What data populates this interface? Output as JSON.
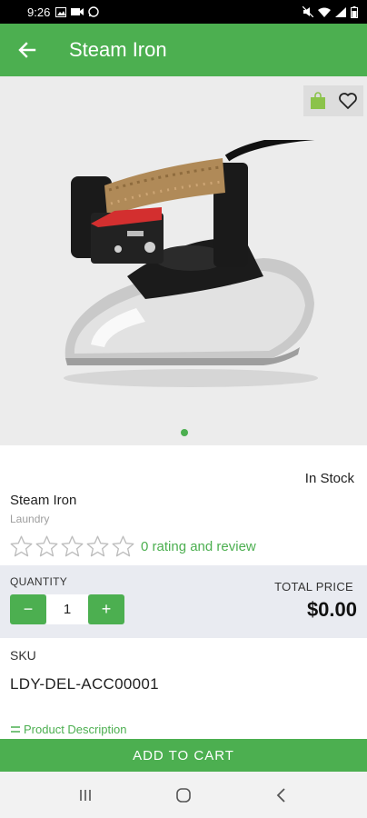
{
  "status_bar": {
    "time": "9:26"
  },
  "app_bar": {
    "title": "Steam Iron"
  },
  "product": {
    "stock_status": "In Stock",
    "name": "Steam Iron",
    "category": "Laundry",
    "rating": 0,
    "rating_text": "0 rating and review"
  },
  "purchase": {
    "quantity_label": "QUANTITY",
    "quantity": "1",
    "decrement_label": "−",
    "increment_label": "+",
    "total_label": "TOTAL PRICE",
    "total_price": "$0.00"
  },
  "sku": {
    "label": "SKU",
    "value": "LDY-DEL-ACC00001"
  },
  "description_link": "Product Description",
  "add_to_cart": "ADD TO CART",
  "colors": {
    "primary": "#4caf50",
    "panel": "#e9ebf1"
  }
}
